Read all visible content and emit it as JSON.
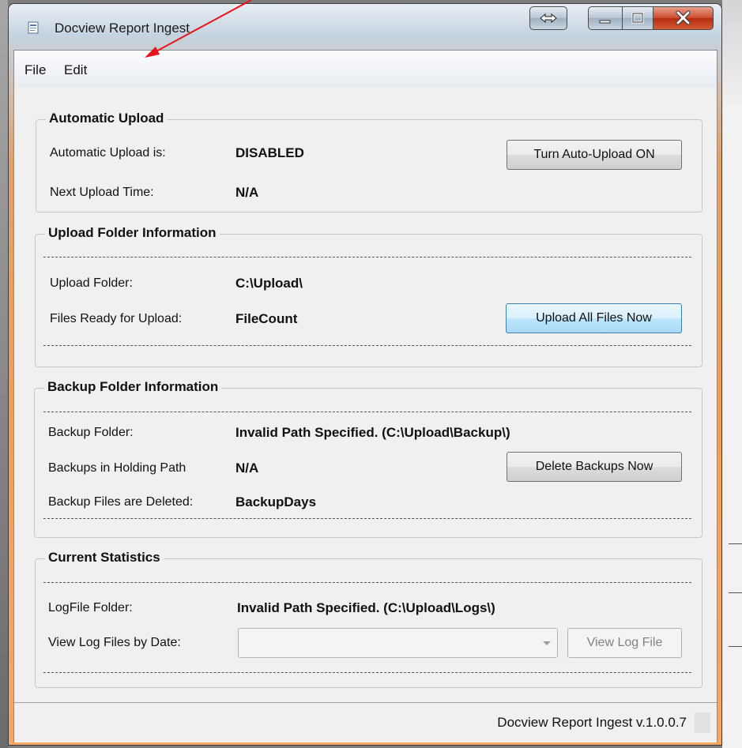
{
  "window": {
    "title": "Docview Report Ingest"
  },
  "menu": {
    "file": "File",
    "edit": "Edit"
  },
  "auto_upload": {
    "group_title": "Automatic Upload",
    "status_label": "Automatic Upload is:",
    "status_value": "DISABLED",
    "toggle_button": "Turn Auto-Upload ON",
    "next_label": "Next Upload Time:",
    "next_value": "N/A"
  },
  "upload_folder": {
    "group_title": "Upload Folder Information",
    "folder_label": "Upload Folder:",
    "folder_value": "C:\\Upload\\",
    "ready_label": "Files Ready for Upload:",
    "ready_value": "FileCount",
    "upload_button": "Upload All Files Now"
  },
  "backup_folder": {
    "group_title": "Backup Folder Information",
    "folder_label": "Backup Folder:",
    "folder_value": "Invalid Path Specified. (C:\\Upload\\Backup\\)",
    "holding_label": "Backups in Holding Path",
    "holding_value": "N/A",
    "delete_button": "Delete Backups Now",
    "deleted_label": "Backup Files are Deleted:",
    "deleted_value": "BackupDays"
  },
  "statistics": {
    "group_title": "Current Statistics",
    "logfile_label": "LogFile Folder:",
    "logfile_value": "Invalid Path Specified. (C:\\Upload\\Logs\\)",
    "view_label": "View Log Files by Date:",
    "view_select_value": "",
    "view_button": "View Log File"
  },
  "status_bar": {
    "text": "Docview Report Ingest v.1.0.0.7"
  },
  "colors": {
    "annotation_arrow": "#e8141b",
    "window_frame_accent": "#f29d57",
    "close_button": "#c7431f"
  },
  "icons": {
    "app": "app-document-icon",
    "resize": "double-arrow-icon",
    "minimize": "minimize-icon",
    "maximize": "maximize-icon",
    "close": "close-x-icon"
  }
}
